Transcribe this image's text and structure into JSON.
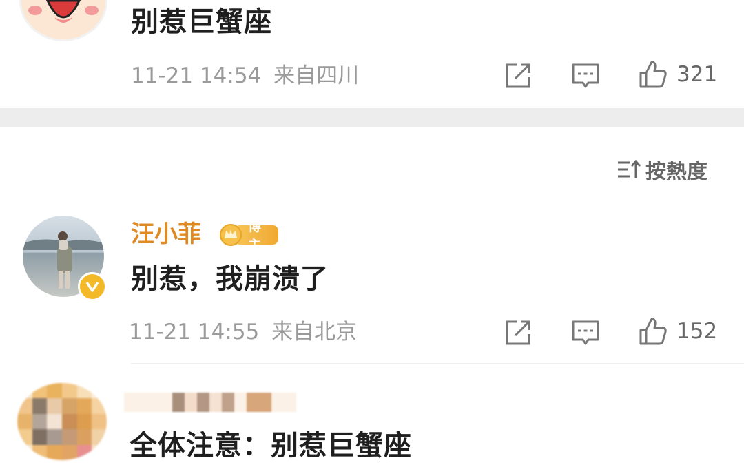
{
  "comments": [
    {
      "text": "别惹巨蟹座",
      "time": "11-21 14:54",
      "location": "来自四川",
      "likes": "321"
    },
    {
      "username": "汪小菲",
      "badge": "博主",
      "text": "别惹，我崩溃了",
      "time": "11-21 14:55",
      "location": "来自北京",
      "likes": "152"
    },
    {
      "text": "全体注意：别惹巨蟹座"
    }
  ],
  "sort": {
    "label": "按熱度"
  },
  "icons": {
    "share": "share-icon",
    "comment": "comment-icon",
    "like": "like-icon",
    "sort": "sort-icon",
    "verified": "verified-icon"
  },
  "colors": {
    "username": "#e08a23",
    "badge": "#f0a932",
    "meta": "#9a9a9a",
    "divider": "#ededed"
  }
}
